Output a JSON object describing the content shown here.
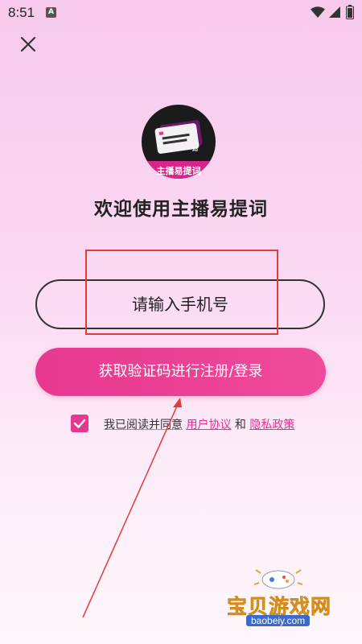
{
  "status_bar": {
    "time": "8:51",
    "notification_icon": "A"
  },
  "header": {
    "close_icon": "close-icon"
  },
  "logo": {
    "caption": "主播易提词",
    "badge": "AI"
  },
  "welcome": {
    "title": "欢迎使用主播易提词"
  },
  "form": {
    "phone_placeholder": "请输入手机号",
    "submit_label": "获取验证码进行注册/登录"
  },
  "agreement": {
    "checked": true,
    "prefix": "我已阅读并同意",
    "user_agreement": "用户协议",
    "and": "和",
    "privacy_policy": "隐私政策"
  },
  "watermark": {
    "title": "宝贝游戏网",
    "url": "baobeiy.com"
  },
  "colors": {
    "accent": "#E7388F",
    "annotation": "#E53A3A"
  }
}
